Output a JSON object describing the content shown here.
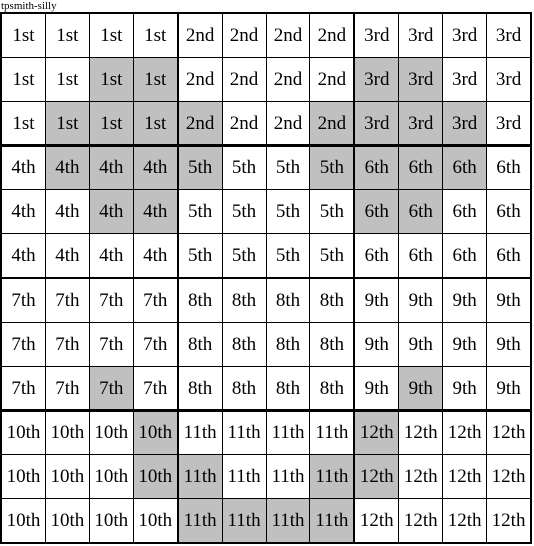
{
  "title": "tpsmith-silly",
  "colors": {
    "shaded": "#c0c0c0",
    "unshaded": "#ffffff",
    "border": "#000000",
    "text": "#000000"
  },
  "grid": {
    "rows": 12,
    "columns": 12,
    "block_rows": 4,
    "block_columns": 3,
    "block_height": 3,
    "block_width": 4,
    "labels": [
      [
        "1st",
        "2nd",
        "3rd"
      ],
      [
        "4th",
        "5th",
        "6th"
      ],
      [
        "7th",
        "8th",
        "9th"
      ],
      [
        "10th",
        "11th",
        "12th"
      ]
    ],
    "cells": [
      [
        "1st",
        "1st",
        "1st",
        "1st",
        "2nd",
        "2nd",
        "2nd",
        "2nd",
        "3rd",
        "3rd",
        "3rd",
        "3rd"
      ],
      [
        "1st",
        "1st",
        "1st",
        "1st",
        "2nd",
        "2nd",
        "2nd",
        "2nd",
        "3rd",
        "3rd",
        "3rd",
        "3rd"
      ],
      [
        "1st",
        "1st",
        "1st",
        "1st",
        "2nd",
        "2nd",
        "2nd",
        "2nd",
        "3rd",
        "3rd",
        "3rd",
        "3rd"
      ],
      [
        "4th",
        "4th",
        "4th",
        "4th",
        "5th",
        "5th",
        "5th",
        "5th",
        "6th",
        "6th",
        "6th",
        "6th"
      ],
      [
        "4th",
        "4th",
        "4th",
        "4th",
        "5th",
        "5th",
        "5th",
        "5th",
        "6th",
        "6th",
        "6th",
        "6th"
      ],
      [
        "4th",
        "4th",
        "4th",
        "4th",
        "5th",
        "5th",
        "5th",
        "5th",
        "6th",
        "6th",
        "6th",
        "6th"
      ],
      [
        "7th",
        "7th",
        "7th",
        "7th",
        "8th",
        "8th",
        "8th",
        "8th",
        "9th",
        "9th",
        "9th",
        "9th"
      ],
      [
        "7th",
        "7th",
        "7th",
        "7th",
        "8th",
        "8th",
        "8th",
        "8th",
        "9th",
        "9th",
        "9th",
        "9th"
      ],
      [
        "7th",
        "7th",
        "7th",
        "7th",
        "8th",
        "8th",
        "8th",
        "8th",
        "9th",
        "9th",
        "9th",
        "9th"
      ],
      [
        "10th",
        "10th",
        "10th",
        "10th",
        "11th",
        "11th",
        "11th",
        "11th",
        "12th",
        "12th",
        "12th",
        "12th"
      ],
      [
        "10th",
        "10th",
        "10th",
        "10th",
        "11th",
        "11th",
        "11th",
        "11th",
        "12th",
        "12th",
        "12th",
        "12th"
      ],
      [
        "10th",
        "10th",
        "10th",
        "10th",
        "11th",
        "11th",
        "11th",
        "11th",
        "12th",
        "12th",
        "12th",
        "12th"
      ]
    ],
    "shading": [
      [
        0,
        0,
        0,
        0,
        0,
        0,
        0,
        0,
        0,
        0,
        0,
        0
      ],
      [
        0,
        0,
        1,
        1,
        0,
        0,
        0,
        0,
        1,
        1,
        0,
        0
      ],
      [
        0,
        1,
        1,
        1,
        1,
        0,
        0,
        1,
        1,
        1,
        1,
        0
      ],
      [
        0,
        1,
        1,
        1,
        1,
        0,
        0,
        1,
        1,
        1,
        1,
        0
      ],
      [
        0,
        0,
        1,
        1,
        0,
        0,
        0,
        0,
        1,
        1,
        0,
        0
      ],
      [
        0,
        0,
        0,
        0,
        0,
        0,
        0,
        0,
        0,
        0,
        0,
        0
      ],
      [
        0,
        0,
        0,
        0,
        0,
        0,
        0,
        0,
        0,
        0,
        0,
        0
      ],
      [
        0,
        0,
        0,
        0,
        0,
        0,
        0,
        0,
        0,
        0,
        0,
        0
      ],
      [
        0,
        0,
        1,
        0,
        0,
        0,
        0,
        0,
        0,
        1,
        0,
        0
      ],
      [
        0,
        0,
        0,
        1,
        0,
        0,
        0,
        0,
        1,
        0,
        0,
        0
      ],
      [
        0,
        0,
        0,
        1,
        1,
        0,
        0,
        1,
        1,
        0,
        0,
        0
      ],
      [
        0,
        0,
        0,
        0,
        1,
        1,
        1,
        1,
        0,
        0,
        0,
        0
      ]
    ]
  }
}
